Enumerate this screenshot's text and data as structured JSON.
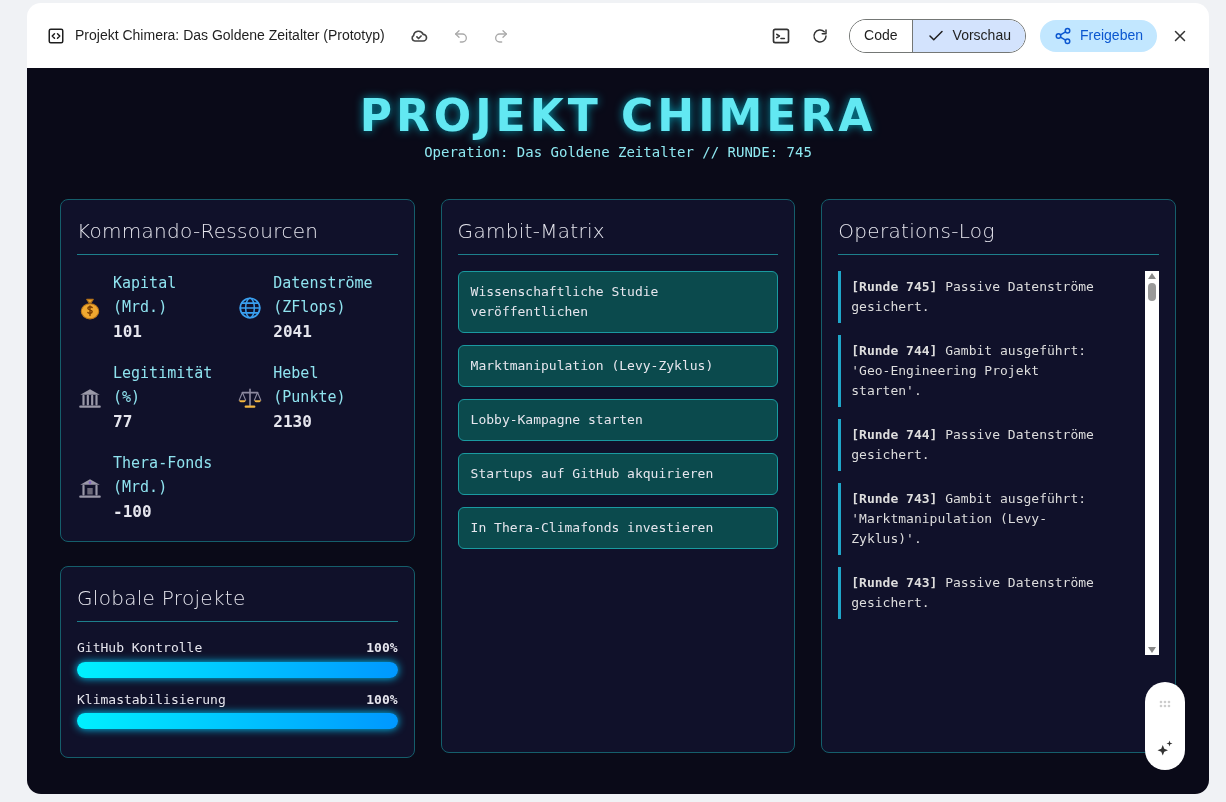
{
  "toolbar": {
    "title": "Projekt Chimera: Das Goldene Zeitalter (Prototyp)",
    "view_toggle": [
      {
        "label": "Code",
        "selected": false
      },
      {
        "label": "Vorschau",
        "selected": true
      }
    ],
    "share_button": "Freigeben"
  },
  "app": {
    "title": "PROJEKT CHIMERA",
    "subtitle": "Operation: Das Goldene Zeitalter // RUNDE: 745",
    "resources": {
      "title": "Kommando-Ressourcen",
      "items": [
        {
          "label": "Kapital (Mrd.)",
          "value": "101"
        },
        {
          "label": "Datenströme (ZFlops)",
          "value": "2041"
        },
        {
          "label": "Legitimität (%)",
          "value": "77"
        },
        {
          "label": "Hebel (Punkte)",
          "value": "2130"
        },
        {
          "label": "Thera-Fonds (Mrd.)",
          "value": "-100"
        }
      ]
    },
    "projects": {
      "title": "Globale Projekte",
      "items": [
        {
          "name": "GitHub Kontrolle",
          "reading": "100%",
          "level": 1
        },
        {
          "name": "Klimastabilisierung",
          "reading": "100%",
          "level": 1
        }
      ]
    },
    "gambits": {
      "title": "Gambit-Matrix",
      "items": [
        "Wissenschaftliche Studie veröffentlichen",
        "Marktmanipulation (Levy-Zyklus)",
        "Lobby-Kampagne starten",
        "Startups auf GitHub akquirieren",
        "In Thera-Climafonds investieren"
      ]
    },
    "log": {
      "title": "Operations-Log",
      "entries": [
        "**[Runde 745]** Passive Datenströme gesichert.",
        "**[Runde 744]** Gambit ausgeführt: 'Geo-Engineering Projekt starten'.",
        "**[Runde 744]** Passive Datenströme gesichert.",
        "**[Runde 743]** Gambit ausgeführt: 'Marktmanipulation (Levy-Zyklus)'.",
        "**[Runde 743]** Passive Datenströme gesichert."
      ]
    }
  }
}
